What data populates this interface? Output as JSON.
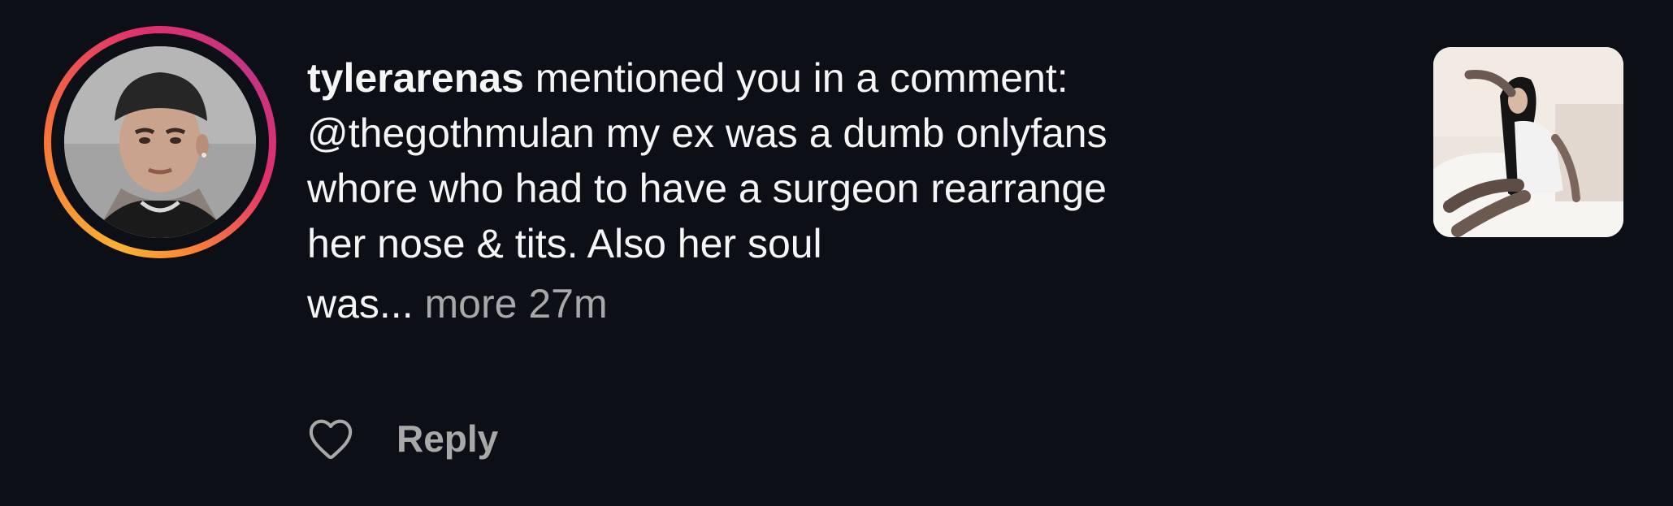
{
  "notification": {
    "username": "tylerarenas",
    "action_text": " mentioned you in a comment:",
    "comment_lines": [
      "@thegothmulan my ex was a dumb onlyfans",
      "whore who had to have a surgeon rearrange",
      "her nose & tits. Also her soul"
    ],
    "comment_tail": "was...",
    "more_label": "more",
    "timestamp": "27m",
    "reply_label": "Reply"
  },
  "icons": {
    "like": "heart-icon",
    "avatar": "profile-photo",
    "thumbnail": "post-thumbnail"
  },
  "colors": {
    "background": "#0c0f16",
    "text": "#f5f5f5",
    "secondary_text": "#a8a8a8",
    "story_ring": [
      "#f9b233",
      "#f77737",
      "#e1306c",
      "#c13584"
    ]
  }
}
